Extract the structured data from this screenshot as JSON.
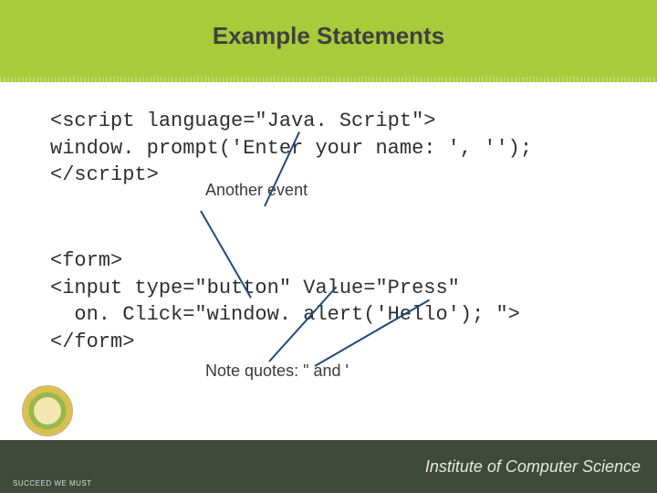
{
  "title": "Example Statements",
  "code": {
    "line1": "<script language=\"Java. Script\">",
    "line2": "window. prompt('Enter your name: ', '');",
    "line3": "</script>",
    "line4": "<form>",
    "line5": "<input type=\"button\" Value=\"Press\"",
    "line6": "  on. Click=\"window. alert('Hello'); \">",
    "line7": "</form>"
  },
  "annotations": {
    "another_event": "Another event",
    "note_quotes": "Note quotes: \" and '"
  },
  "footer": {
    "institute": "Institute of Computer Science",
    "motto": "SUCCEED WE MUST"
  }
}
